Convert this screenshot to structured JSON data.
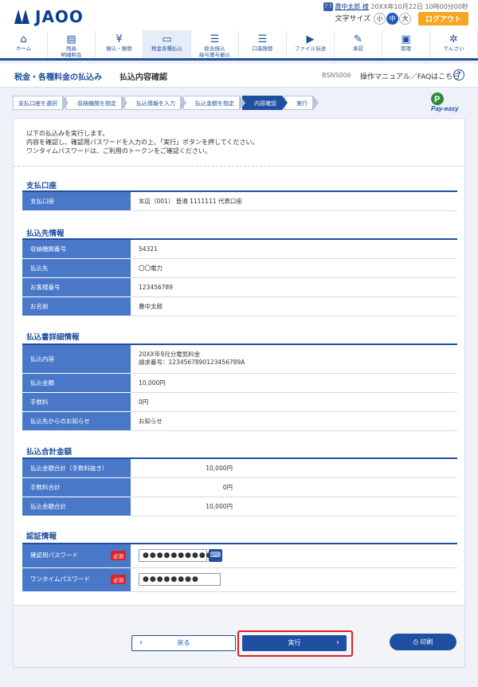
{
  "brand": {
    "logo": "JAOO"
  },
  "user": {
    "badge": "ﾌﾞﾗ",
    "name": "農中太郎 様",
    "login_time": "20XX年10月22日 10時00分00秒"
  },
  "font_size": {
    "label": "文字サイズ",
    "small": "小",
    "medium": "中",
    "large": "大",
    "selected": "中"
  },
  "logout": "ログアウト",
  "nav": [
    {
      "icon": "home-icon",
      "glyph": "⌂",
      "label": "ホーム"
    },
    {
      "icon": "balance-icon",
      "glyph": "▤",
      "label": "残高\n明細照会"
    },
    {
      "icon": "yen-icon",
      "glyph": "¥",
      "label": "振込・振替"
    },
    {
      "icon": "tax-icon",
      "glyph": "▭",
      "label": "税金各種払込"
    },
    {
      "icon": "bulk-transfer-icon",
      "glyph": "☰",
      "label": "総合振込\n給与賞与振込"
    },
    {
      "icon": "debit-icon",
      "glyph": "☰",
      "label": "口座振替"
    },
    {
      "icon": "file-icon",
      "glyph": "▶",
      "label": "ファイル伝送"
    },
    {
      "icon": "approve-icon",
      "glyph": "✎",
      "label": "承認"
    },
    {
      "icon": "admin-icon",
      "glyph": "▣",
      "label": "管理"
    },
    {
      "icon": "e-sign-icon",
      "glyph": "✲",
      "label": "でんさい"
    }
  ],
  "header": {
    "section": "税金・各種料金の払込み",
    "title": "払込内容確認",
    "screen_id": "BSNS006",
    "help": "操作マニュアル／FAQはこちら"
  },
  "steps": [
    "支払口座を選択",
    "収納機関を指定",
    "払込情報を入力",
    "払込金額を指定",
    "内容確認",
    "実行"
  ],
  "current_step": "内容確認",
  "payeasy": "Pay-easy",
  "intro": [
    "以下の払込みを実行します。",
    "内容を確認し、確認用パスワードを入力の上、「実行」ボタンを押してください。",
    "ワンタイムパスワードは、ご利用のトークンをご確認ください。"
  ],
  "sections": {
    "account": {
      "title": "支払口座",
      "rows": [
        {
          "label": "支払口座",
          "value": "本店（001） 普通 1111111 代表口座"
        }
      ]
    },
    "payee": {
      "title": "払込先情報",
      "rows": [
        {
          "label": "収納機関番号",
          "value": "54321"
        },
        {
          "label": "払込先",
          "value": "〇〇電力"
        },
        {
          "label": "お客様番号",
          "value": "123456789"
        },
        {
          "label": "お名前",
          "value": "農中太郎"
        }
      ]
    },
    "detail": {
      "title": "払込書詳細情報",
      "rows": [
        {
          "label": "払込内容",
          "value": "20XX年9月分電気料金",
          "value2": "請求番号：1234567890123456789A"
        },
        {
          "label": "払込金額",
          "value": "10,000円"
        },
        {
          "label": "手数料",
          "value": "0円"
        },
        {
          "label": "払込先からのお知らせ",
          "value": "お知らせ"
        }
      ]
    },
    "total": {
      "title": "払込合計金額",
      "rows": [
        {
          "label": "払込金額合計（手数料抜き）",
          "value": "10,000円"
        },
        {
          "label": "手数料合計",
          "value": "0円"
        },
        {
          "label": "払込金額合計",
          "value": "10,000円"
        }
      ]
    },
    "auth": {
      "title": "認証情報",
      "required": "必須",
      "rows": [
        {
          "label": "確認用パスワード",
          "value": "●●●●●●●●●●"
        },
        {
          "label": "ワンタイムパスワード",
          "value": "●●●●●●●●"
        }
      ]
    }
  },
  "buttons": {
    "back": "戻る",
    "execute": "実行",
    "print": "印刷"
  }
}
